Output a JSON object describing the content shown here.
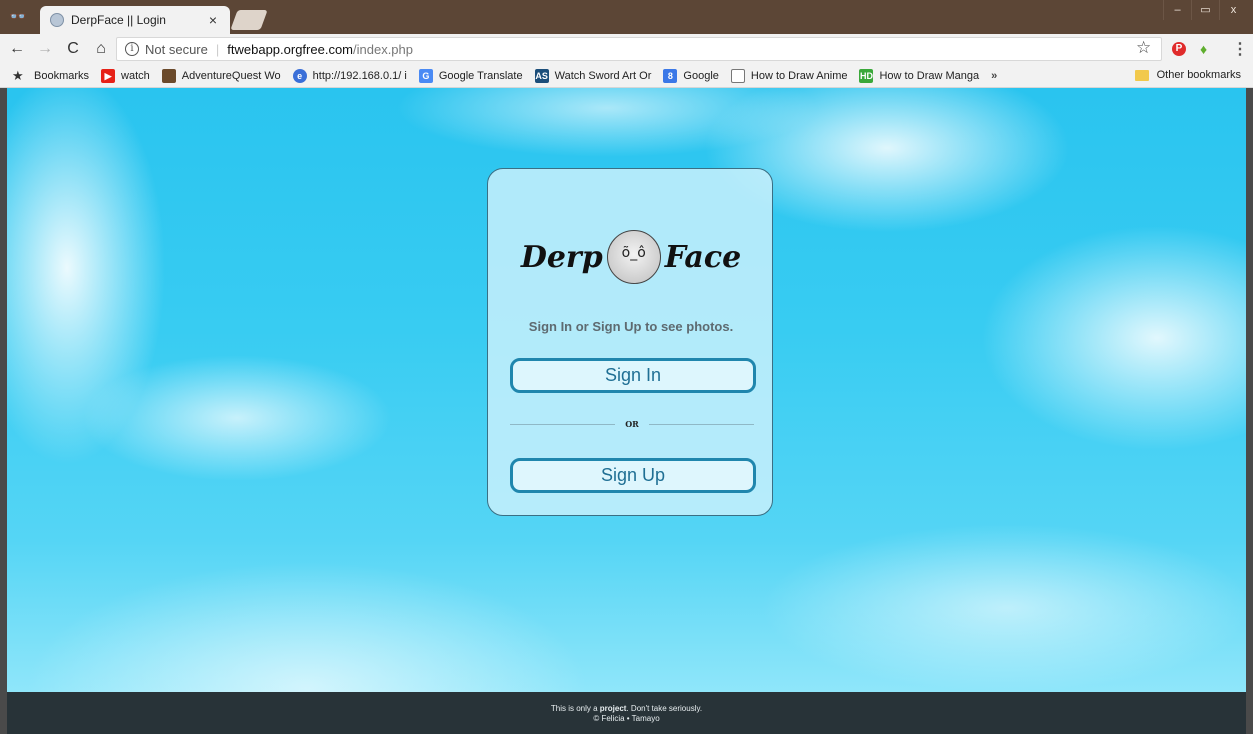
{
  "browser": {
    "tab": {
      "title": "DerpFace || Login",
      "close": "×"
    },
    "window_controls": [
      "–",
      "▭",
      "x"
    ],
    "address": {
      "security": "Not secure",
      "host": "ftwebapp.orgfree.com",
      "path": "/index.php"
    },
    "bookmarks": [
      {
        "label": "Bookmarks",
        "icon": "star-icon"
      },
      {
        "label": "watch",
        "icon": "youtube-icon",
        "color": "#e62117"
      },
      {
        "label": "AdventureQuest Wo",
        "icon": "aq-icon",
        "color": "#6b4a2b"
      },
      {
        "label": "http://192.168.0.1/ i",
        "icon": "globe-icon",
        "color": "#3a6fd8"
      },
      {
        "label": "Google Translate",
        "icon": "translate-icon",
        "color": "#4a8af4"
      },
      {
        "label": "Watch Sword Art Or",
        "icon": "as-icon",
        "color": "#1c4e7a"
      },
      {
        "label": "Google",
        "icon": "google-icon",
        "color": "#3b78e7"
      },
      {
        "label": "How to Draw Anime",
        "icon": "page-icon",
        "color": "#777777"
      },
      {
        "label": "How to Draw Manga",
        "icon": "hd-icon",
        "color": "#3aa83a"
      }
    ],
    "bookmarks_more": "»",
    "other_bookmarks": "Other bookmarks"
  },
  "login": {
    "logo_left": "Derp",
    "logo_right": "Face",
    "tagline": "Sign In or Sign Up to see photos.",
    "sign_in": "Sign In",
    "or": "OR",
    "sign_up": "Sign Up"
  },
  "footer": {
    "line1_a": "This is only a ",
    "line1_b": "project",
    "line1_c": ". Don't take seriously.",
    "line2": "© Felicia • Tamayo"
  },
  "colors": {
    "accent": "#1f86ad",
    "footer_bg": "#283338",
    "sky": "#2ac4ef"
  }
}
